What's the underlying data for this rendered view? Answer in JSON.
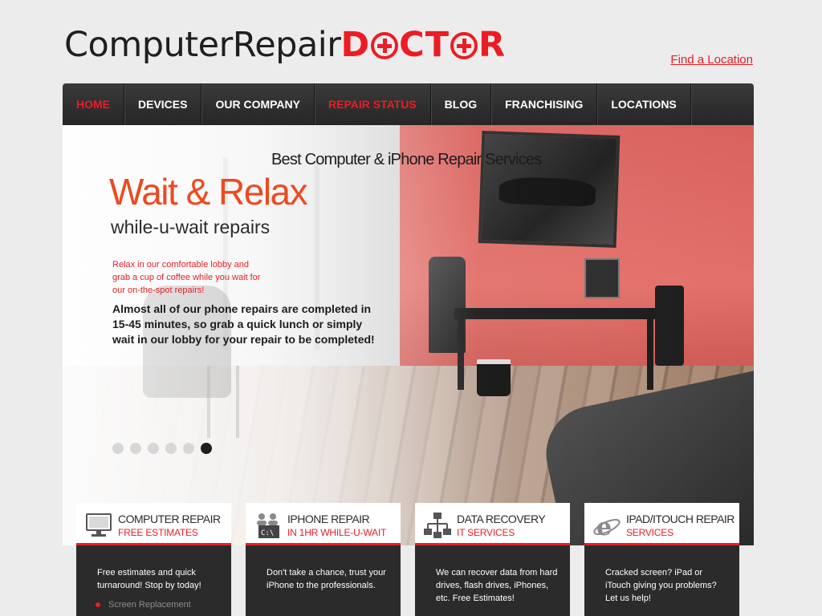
{
  "header": {
    "logo": {
      "part1": "ComputerRepair",
      "part2_pre": "D",
      "part2_post": "CT",
      "part2_end": "R"
    },
    "find_location": "Find a Location"
  },
  "nav": {
    "items": [
      {
        "label": "HOME",
        "active": true
      },
      {
        "label": "DEVICES"
      },
      {
        "label": "OUR COMPANY"
      },
      {
        "label": "REPAIR STATUS",
        "highlight": true
      },
      {
        "label": "BLOG"
      },
      {
        "label": "FRANCHISING"
      },
      {
        "label": "LOCATIONS"
      }
    ]
  },
  "hero": {
    "eyebrow": "Best Computer & iPhone Repair Services",
    "title": "Wait & Relax",
    "subtitle": "while-u-wait repairs",
    "red_text": "Relax in our comfortable lobby and grab a cup of coffee while you wait for our on-the-spot repairs!",
    "bold_text": "Almost all of our phone repairs are completed in 15-45 minutes, so grab a quick lunch or simply wait in our lobby for your repair to be completed!",
    "slides": 6,
    "active_slide": 6
  },
  "cards": [
    {
      "icon": "monitor-icon",
      "title": "COMPUTER REPAIR",
      "subtitle": "FREE ESTIMATES",
      "body": "Free estimates and quick turnaround! Stop by today!",
      "list": [
        "Screen Replacement"
      ]
    },
    {
      "icon": "terminal-users-icon",
      "title": "IPHONE REPAIR",
      "subtitle": "IN 1HR WHILE-U-WAIT",
      "body": "Don't take a chance, trust your iPhone to the professionals."
    },
    {
      "icon": "network-icon",
      "title": "DATA RECOVERY",
      "subtitle": "IT SERVICES",
      "body": "We can recover data from hard drives, flash drives, iPhones, etc. Free Estimates!"
    },
    {
      "icon": "internet-explorer-icon",
      "title": "IPAD/ITOUCH REPAIR",
      "subtitle": "SERVICES",
      "body": "Cracked screen? iPad or iTouch giving you problems? Let us help!"
    }
  ],
  "colors": {
    "brand_red": "#ec1c24",
    "hero_orange": "#ec4a21",
    "nav_dark": "#2b2b2b",
    "card_dark": "#2b2b2b"
  }
}
